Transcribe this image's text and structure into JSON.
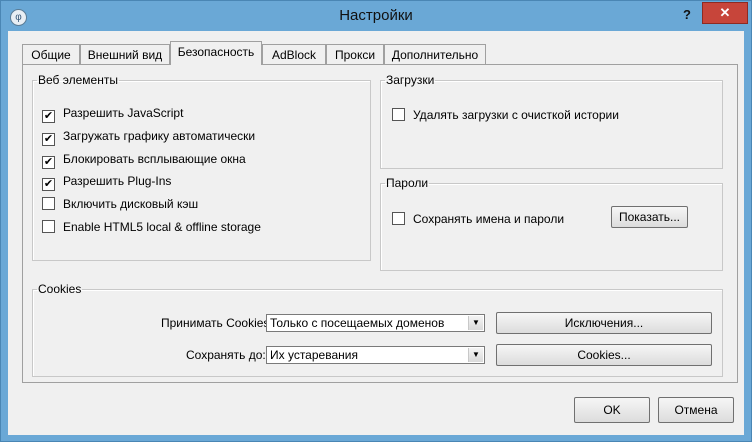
{
  "window": {
    "title": "Настройки",
    "help": "?",
    "close": "✕"
  },
  "tabs": [
    "Общие",
    "Внешний вид",
    "Безопасность",
    "AdBlock",
    "Прокси",
    "Дополнительно"
  ],
  "web": {
    "legend": "Веб элементы",
    "items": [
      {
        "label": "Разрешить JavaScript",
        "checked": true
      },
      {
        "label": "Загружать графику автоматически",
        "checked": true
      },
      {
        "label": "Блокировать всплывающие окна",
        "checked": true
      },
      {
        "label": "Разрешить Plug-Ins",
        "checked": true
      },
      {
        "label": "Включить дисковый кэш",
        "checked": false
      },
      {
        "label": "Enable HTML5 local & offline storage",
        "checked": false
      }
    ]
  },
  "downloads": {
    "legend": "Загрузки",
    "clear_label": "Удалять загрузки с очисткой истории",
    "checked": false
  },
  "passwords": {
    "legend": "Пароли",
    "save_label": "Сохранять имена и пароли",
    "checked": false,
    "show_button": "Показать..."
  },
  "cookies": {
    "legend": "Cookies",
    "accept_label": "Принимать Cookies:",
    "accept_value": "Только с посещаемых доменов",
    "exceptions_button": "Исключения...",
    "keep_label": "Сохранять до:",
    "keep_value": "Их устаревания",
    "cookies_button": "Cookies..."
  },
  "footer": {
    "ok": "OK",
    "cancel": "Отмена"
  },
  "icons": {
    "check": "✔",
    "dropdown": "▼"
  }
}
